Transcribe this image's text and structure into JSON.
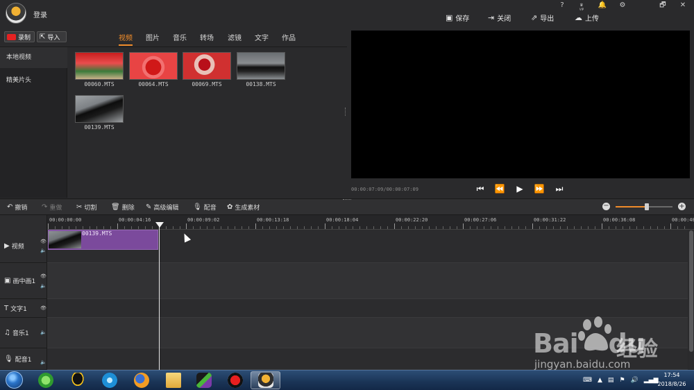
{
  "app": {
    "login": "登录",
    "window_buttons": [
      "?",
      "VIP",
      "🔔",
      "⚙",
      "🗗",
      "✕"
    ],
    "top_actions": [
      {
        "label": "保存",
        "icon": "save-icon"
      },
      {
        "label": "关闭",
        "icon": "close-project-icon"
      },
      {
        "label": "导出",
        "icon": "export-icon"
      },
      {
        "label": "上传",
        "icon": "upload-icon"
      }
    ]
  },
  "library": {
    "record_label": "录制",
    "import_label": "导入",
    "tabs": [
      {
        "label": "视频",
        "active": true
      },
      {
        "label": "图片",
        "active": false
      },
      {
        "label": "音乐",
        "active": false
      },
      {
        "label": "转场",
        "active": false
      },
      {
        "label": "滤镜",
        "active": false
      },
      {
        "label": "文字",
        "active": false
      },
      {
        "label": "作品",
        "active": false
      }
    ],
    "sidebar": [
      {
        "label": "本地视频",
        "active": true
      },
      {
        "label": "精美片头",
        "active": false
      }
    ],
    "media": [
      {
        "name": "00060.MTS"
      },
      {
        "name": "00064.MTS"
      },
      {
        "name": "00069.MTS"
      },
      {
        "name": "00138.MTS"
      },
      {
        "name": "00139.MTS"
      }
    ]
  },
  "preview": {
    "timecode": "00:00:07:09/00:00:07:09"
  },
  "edit_toolbar": {
    "undo": "撤销",
    "redo": "重做",
    "cut": "切割",
    "delete": "删除",
    "advanced": "高级编辑",
    "dub": "配音",
    "generate": "生成素材",
    "zoom_level": 0.55
  },
  "timeline": {
    "ruler": [
      "00:00:00:00",
      "00:00:04:16",
      "00:00:09:02",
      "00:00:13:18",
      "00:00:18:04",
      "00:00:22:20",
      "00:00:27:06",
      "00:00:31:22",
      "00:00:36:08",
      "00:00:40:"
    ],
    "tracks": [
      {
        "label": "视频"
      },
      {
        "label": "画中画1"
      },
      {
        "label": "文字1"
      },
      {
        "label": "音乐1"
      },
      {
        "label": "配音1"
      }
    ],
    "clip_label": "00139.MTS"
  },
  "taskbar": {
    "time": "17:54",
    "date": "2018/8/26"
  },
  "watermark": {
    "brand": "Bai",
    "brand2": "du",
    "cn": "经验",
    "url": "jingyan.baidu.com"
  }
}
